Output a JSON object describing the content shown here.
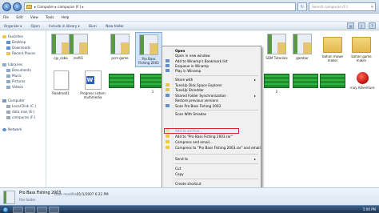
{
  "address": {
    "path": "▸ Computer ▸ campuran (F:) ▸",
    "search_placeholder": "Search campuran (F:)"
  },
  "menu": [
    "File",
    "Edit",
    "View",
    "Tools",
    "Help"
  ],
  "commands": [
    "Organize ▾",
    "Open",
    "Include in library ▾",
    "Burn",
    "New folder"
  ],
  "nav": {
    "favorites": "Favorites",
    "favorite_items": [
      "Desktop",
      "Downloads",
      "Recent Places"
    ],
    "libraries": "Libraries",
    "library_items": [
      "Documents",
      "Music",
      "Pictures",
      "Videos"
    ],
    "computer": "Computer",
    "drives": [
      "Local Disk (C:)",
      "data mas (E:)",
      "campuran (F:)"
    ],
    "network": "Network"
  },
  "files": {
    "row1": [
      "cjp_coba",
      "resfil1",
      "pcm game",
      "Pro Bass Fishing 2003",
      "SDM Tutorials",
      "gambar",
      "bahan mowe maker",
      "bahan game maker"
    ],
    "row2": [
      "Readme01",
      "Progress sistem multimedia",
      "",
      "1",
      "2",
      "",
      "",
      "rnay Adventure"
    ]
  },
  "context_menu": {
    "open": "Open",
    "items": [
      "Open in new window",
      "Add to Winamp's Bookmark list",
      "Enqueue in Winamp",
      "Play in Winamp",
      "Share with",
      "TuneUp Disk Space Explorer",
      "TuneUp Shredder",
      "Shared Folder Synchronization",
      "Restore previous versions",
      "Scan Pro Bass Fishing 2003",
      "Scan With Smadav",
      "Add to archive...",
      "Add to \"Pro Bass Fishing 2003.rar\"",
      "Compress and email...",
      "Compress to \"Pro Bass Fishing 2003.rar\" and email",
      "Send to",
      "Cut",
      "Copy",
      "Create shortcut",
      "Delete",
      "Rename",
      "Properties"
    ]
  },
  "details": {
    "name": "Pro Bass Fishing 2003",
    "date_modified_label": "Date modified:",
    "date_modified": "11/1/2007 6:22 PM",
    "type": "File folder"
  },
  "taskbar": {
    "clock": "5:06 PM"
  }
}
